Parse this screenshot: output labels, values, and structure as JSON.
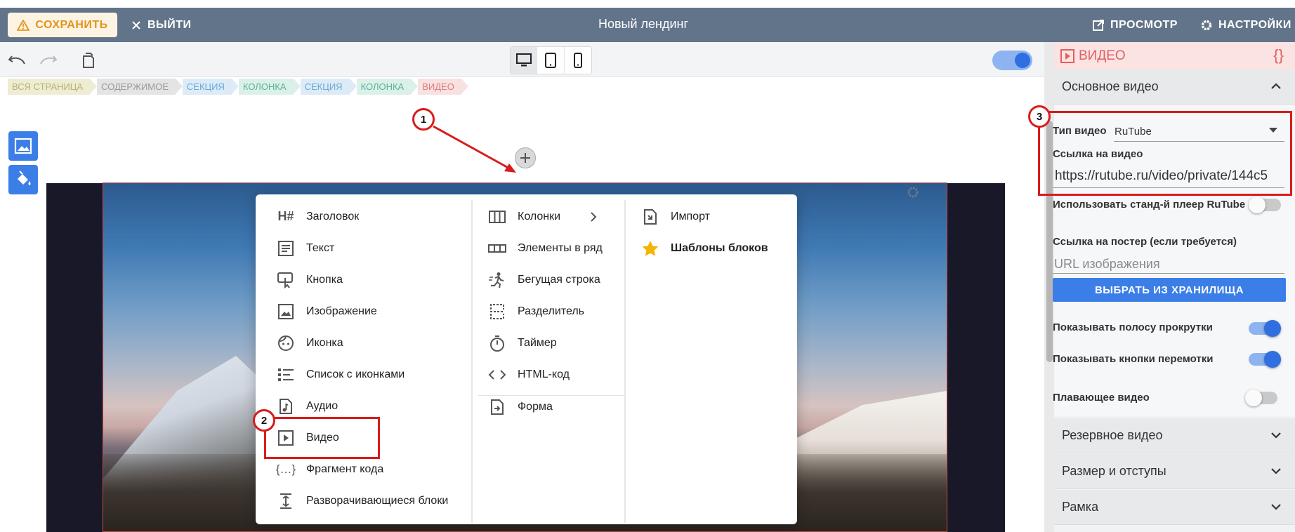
{
  "header": {
    "save_label": "СОХРАНИТЬ",
    "exit_label": "ВЫЙТИ",
    "title": "Новый лендинг",
    "preview_label": "ПРОСМОТР",
    "settings_label": "НАСТРОЙКИ"
  },
  "breadcrumb": [
    {
      "label": "ВСЯ СТРАНИЦА",
      "bg": "#efecd4",
      "color": "#b8b273"
    },
    {
      "label": "СОДЕРЖИМОЕ",
      "bg": "#e4e4e4",
      "color": "#9a9a9a"
    },
    {
      "label": "СЕКЦИЯ",
      "bg": "#dcebf7",
      "color": "#6aaad6"
    },
    {
      "label": "КОЛОНКА",
      "bg": "#dcf0ea",
      "color": "#58b39a"
    },
    {
      "label": "СЕКЦИЯ",
      "bg": "#dcebf7",
      "color": "#6aaad6"
    },
    {
      "label": "КОЛОНКА",
      "bg": "#dcf0ea",
      "color": "#58b39a"
    },
    {
      "label": "ВИДЕО",
      "bg": "#f8e1e1",
      "color": "#e07a7a"
    }
  ],
  "menu": {
    "col1": [
      "Заголовок",
      "Текст",
      "Кнопка",
      "Изображение",
      "Иконка",
      "Список с иконками",
      "Аудио",
      "Видео",
      "Фрагмент кода",
      "Разворачивающиеся блоки"
    ],
    "col2": [
      "Колонки",
      "Элементы в ряд",
      "Бегущая строка",
      "Разделитель",
      "Таймер",
      "HTML-код",
      "Форма"
    ],
    "col3": [
      "Импорт",
      "Шаблоны блоков"
    ]
  },
  "annotations": [
    "1",
    "2",
    "3"
  ],
  "panel": {
    "header_title": "ВИДЕО",
    "header_code": "{}",
    "section_main": "Основное видео",
    "video_type_label": "Тип видео",
    "video_type_value": "RuTube",
    "video_link_label": "Ссылка на видео",
    "video_link_value": "https://rutube.ru/video/private/144c5",
    "std_player_label": "Использовать станд-й плеер RuTube",
    "poster_label": "Ссылка на постер (если требуется)",
    "poster_placeholder": "URL изображения",
    "storage_button": "ВЫБРАТЬ ИЗ ХРАНИЛИЩА",
    "scrollbar_label": "Показывать полосу прокрутки",
    "rewind_label": "Показывать кнопки перемотки",
    "floating_label": "Плавающее видео",
    "section_backup": "Резервное видео",
    "section_size": "Размер и отступы",
    "section_border": "Рамка"
  },
  "toggles": {
    "std_player": false,
    "scrollbar": true,
    "rewind": true,
    "floating": false,
    "top_toggle": true
  },
  "colors": {
    "topbar": "#62748a",
    "accent": "#3c7ee8",
    "annotation": "#d81c1c"
  }
}
